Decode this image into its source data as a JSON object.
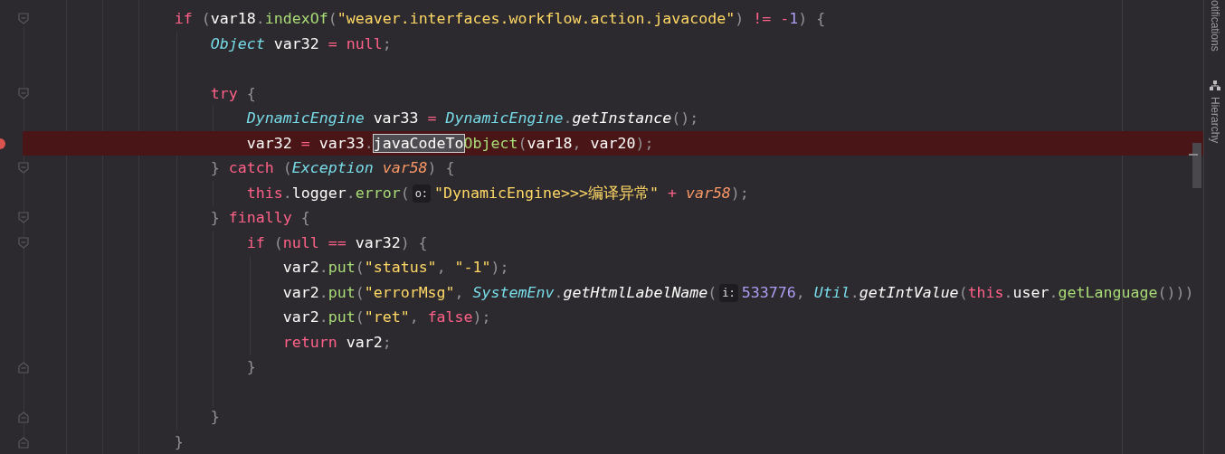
{
  "editor": {
    "lines": [
      {
        "kind": "code",
        "fold_start": true,
        "tokens": [
          {
            "kind": "keyword",
            "text": "                if "
          },
          {
            "kind": "punct",
            "text": "("
          },
          {
            "kind": "plain",
            "text": "var18"
          },
          {
            "kind": "punct",
            "text": "."
          },
          {
            "kind": "method",
            "text": "indexOf"
          },
          {
            "kind": "punct",
            "text": "("
          },
          {
            "kind": "string",
            "text": "\"weaver.interfaces.workflow.action.javacode\""
          },
          {
            "kind": "punct",
            "text": ") "
          },
          {
            "kind": "keyword",
            "text": "!= -"
          },
          {
            "kind": "number",
            "text": "1"
          },
          {
            "kind": "punct",
            "text": ") {"
          }
        ]
      },
      {
        "kind": "code",
        "tokens": [
          {
            "kind": "type",
            "text": "                    Object"
          },
          {
            "kind": "plain",
            "text": " var32 "
          },
          {
            "kind": "keyword",
            "text": "= null"
          },
          {
            "kind": "punct",
            "text": ";"
          }
        ]
      },
      {
        "kind": "blank"
      },
      {
        "kind": "code",
        "fold_start": true,
        "tokens": [
          {
            "kind": "keyword",
            "text": "                    try "
          },
          {
            "kind": "punct",
            "text": "{"
          }
        ]
      },
      {
        "kind": "code",
        "tokens": [
          {
            "kind": "type",
            "text": "                        DynamicEngine"
          },
          {
            "kind": "plain",
            "text": " var33 "
          },
          {
            "kind": "keyword",
            "text": "= "
          },
          {
            "kind": "type",
            "text": "DynamicEngine"
          },
          {
            "kind": "punct",
            "text": "."
          },
          {
            "kind": "call",
            "text": "getInstance"
          },
          {
            "kind": "punct",
            "text": "();"
          }
        ]
      },
      {
        "kind": "code",
        "highlighted": true,
        "breakpoint": true,
        "tokens": [
          {
            "kind": "plain",
            "text": "                        var32 "
          },
          {
            "kind": "keyword",
            "text": "= "
          },
          {
            "kind": "plain",
            "text": "var33"
          },
          {
            "kind": "punct",
            "text": "."
          },
          {
            "kind": "match",
            "text": "javaCodeTo"
          },
          {
            "kind": "method",
            "text": "Object"
          },
          {
            "kind": "punct",
            "text": "("
          },
          {
            "kind": "plain",
            "text": "var18"
          },
          {
            "kind": "punct",
            "text": ", "
          },
          {
            "kind": "plain",
            "text": "var20"
          },
          {
            "kind": "punct",
            "text": ");"
          }
        ]
      },
      {
        "kind": "code",
        "fold_start": true,
        "tokens": [
          {
            "kind": "punct",
            "text": "                    } "
          },
          {
            "kind": "keyword",
            "text": "catch "
          },
          {
            "kind": "punct",
            "text": "("
          },
          {
            "kind": "type",
            "text": "Exception "
          },
          {
            "kind": "param",
            "text": "var58"
          },
          {
            "kind": "punct",
            "text": ") {"
          }
        ]
      },
      {
        "kind": "code",
        "tokens": [
          {
            "kind": "keyword",
            "text": "                        this"
          },
          {
            "kind": "punct",
            "text": "."
          },
          {
            "kind": "plain",
            "text": "logger"
          },
          {
            "kind": "punct",
            "text": "."
          },
          {
            "kind": "method",
            "text": "error"
          },
          {
            "kind": "punct",
            "text": "("
          },
          {
            "kind": "hint",
            "text": "o:"
          },
          {
            "kind": "string",
            "text": "\"DynamicEngine>>>编译异常\" "
          },
          {
            "kind": "keyword",
            "text": "+ "
          },
          {
            "kind": "param",
            "text": "var58"
          },
          {
            "kind": "punct",
            "text": ");"
          }
        ]
      },
      {
        "kind": "code",
        "fold_start": true,
        "tokens": [
          {
            "kind": "punct",
            "text": "                    } "
          },
          {
            "kind": "keyword",
            "text": "finally "
          },
          {
            "kind": "punct",
            "text": "{"
          }
        ]
      },
      {
        "kind": "code",
        "fold_start": true,
        "tokens": [
          {
            "kind": "keyword",
            "text": "                        if "
          },
          {
            "kind": "punct",
            "text": "("
          },
          {
            "kind": "keyword",
            "text": "null == "
          },
          {
            "kind": "plain",
            "text": "var32"
          },
          {
            "kind": "punct",
            "text": ") {"
          }
        ]
      },
      {
        "kind": "code",
        "tokens": [
          {
            "kind": "plain",
            "text": "                            var2"
          },
          {
            "kind": "punct",
            "text": "."
          },
          {
            "kind": "method",
            "text": "put"
          },
          {
            "kind": "punct",
            "text": "("
          },
          {
            "kind": "string",
            "text": "\"status\""
          },
          {
            "kind": "punct",
            "text": ", "
          },
          {
            "kind": "string",
            "text": "\"-1\""
          },
          {
            "kind": "punct",
            "text": ");"
          }
        ]
      },
      {
        "kind": "code",
        "tokens": [
          {
            "kind": "plain",
            "text": "                            var2"
          },
          {
            "kind": "punct",
            "text": "."
          },
          {
            "kind": "method",
            "text": "put"
          },
          {
            "kind": "punct",
            "text": "("
          },
          {
            "kind": "string",
            "text": "\"errorMsg\""
          },
          {
            "kind": "punct",
            "text": ", "
          },
          {
            "kind": "type",
            "text": "SystemEnv"
          },
          {
            "kind": "punct",
            "text": "."
          },
          {
            "kind": "call",
            "text": "getHtmlLabelName"
          },
          {
            "kind": "punct",
            "text": "("
          },
          {
            "kind": "hint",
            "text": "i:"
          },
          {
            "kind": "number",
            "text": "533776"
          },
          {
            "kind": "punct",
            "text": ", "
          },
          {
            "kind": "type",
            "text": "Util"
          },
          {
            "kind": "punct",
            "text": "."
          },
          {
            "kind": "call",
            "text": "getIntValue"
          },
          {
            "kind": "punct",
            "text": "("
          },
          {
            "kind": "keyword",
            "text": "this"
          },
          {
            "kind": "punct",
            "text": "."
          },
          {
            "kind": "plain",
            "text": "user"
          },
          {
            "kind": "punct",
            "text": "."
          },
          {
            "kind": "method",
            "text": "getLanguage"
          },
          {
            "kind": "punct",
            "text": "()))"
          }
        ]
      },
      {
        "kind": "code",
        "tokens": [
          {
            "kind": "plain",
            "text": "                            var2"
          },
          {
            "kind": "punct",
            "text": "."
          },
          {
            "kind": "method",
            "text": "put"
          },
          {
            "kind": "punct",
            "text": "("
          },
          {
            "kind": "string",
            "text": "\"ret\""
          },
          {
            "kind": "punct",
            "text": ", "
          },
          {
            "kind": "keyword",
            "text": "false"
          },
          {
            "kind": "punct",
            "text": ");"
          }
        ]
      },
      {
        "kind": "code",
        "tokens": [
          {
            "kind": "keyword",
            "text": "                            return "
          },
          {
            "kind": "plain",
            "text": "var2"
          },
          {
            "kind": "punct",
            "text": ";"
          }
        ]
      },
      {
        "kind": "code",
        "fold_end": true,
        "tokens": [
          {
            "kind": "punct",
            "text": "                        }"
          }
        ]
      },
      {
        "kind": "blank"
      },
      {
        "kind": "code",
        "fold_end": true,
        "tokens": [
          {
            "kind": "punct",
            "text": "                    }"
          }
        ]
      },
      {
        "kind": "code",
        "fold_end": true,
        "tokens": [
          {
            "kind": "punct",
            "text": "                }"
          }
        ]
      }
    ]
  },
  "tool_window_strip": [
    {
      "label": "otifications",
      "has_icon": false
    },
    {
      "label": "Hierarchy",
      "has_icon": true
    }
  ]
}
